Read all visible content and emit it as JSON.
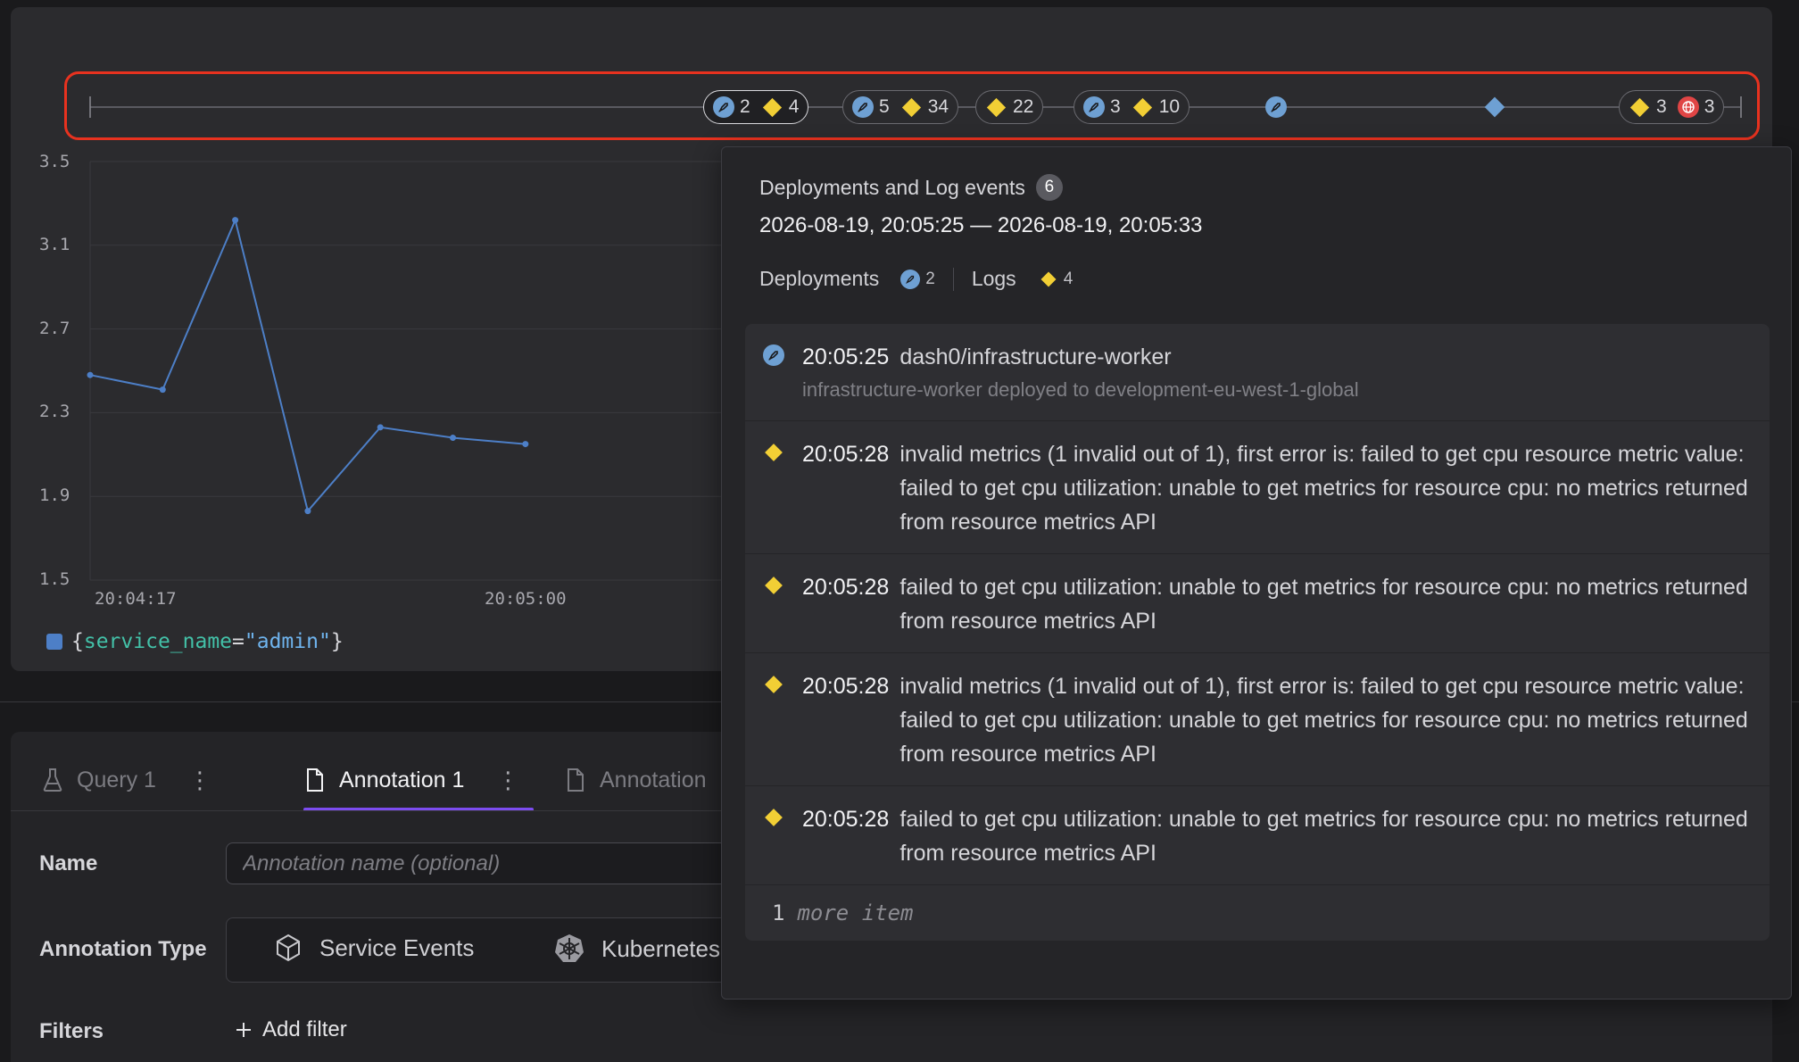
{
  "chart_data": {
    "type": "line",
    "series": [
      {
        "name": "{service_name=\"admin\"}",
        "x": [
          "20:04:17",
          "20:04:25",
          "20:04:33",
          "20:04:41",
          "20:04:49",
          "20:04:57",
          "20:05:05"
        ],
        "values": [
          2.48,
          2.41,
          3.22,
          1.83,
          2.23,
          2.18,
          2.15
        ],
        "color": "#4d7fc7"
      }
    ],
    "yticks": [
      "3.5",
      "3.1",
      "2.7",
      "2.3",
      "1.9",
      "1.5"
    ],
    "ylim": [
      1.5,
      3.5
    ],
    "xticks": [
      "20:04:17",
      "20:05:00"
    ],
    "grid": true,
    "legend_placement": "bottom-left"
  },
  "legend": {
    "open": "{",
    "key": "service_name",
    "eq": "=",
    "value": "\"admin\"",
    "close": "}"
  },
  "timeline": {
    "pills": [
      {
        "deploys": "2",
        "logs": "4",
        "active": true
      },
      {
        "deploys": "5",
        "logs": "34"
      },
      {
        "logs": "22"
      },
      {
        "deploys": "3",
        "logs": "10"
      },
      {
        "logs": "3",
        "errors": "3"
      }
    ],
    "colors": {
      "deploy": "#6ea0d3",
      "log": "#f2cf35",
      "error": "#e04545",
      "highlight_frame": "#e8321f"
    }
  },
  "tooltip": {
    "title": "Deployments and Log events",
    "count": "6",
    "range": "2026-08-19, 20:05:25 — 2026-08-19, 20:05:33",
    "deployments_label": "Deployments",
    "deployments_count": "2",
    "logs_label": "Logs",
    "logs_count": "4",
    "items": [
      {
        "kind": "deploy",
        "time": "20:05:25",
        "message": "dash0/infrastructure-worker",
        "detail": "infrastructure-worker deployed to development-eu-west-1-global"
      },
      {
        "kind": "log",
        "time": "20:05:28",
        "message": "invalid metrics (1 invalid out of 1), first error is: failed to get cpu resource metric value: failed to get cpu utilization: unable to get metrics for resource cpu: no metrics returned from resource metrics API"
      },
      {
        "kind": "log",
        "time": "20:05:28",
        "message": "failed to get cpu utilization: unable to get metrics for resource cpu: no metrics returned from resource metrics API"
      },
      {
        "kind": "log",
        "time": "20:05:28",
        "message": "invalid metrics (1 invalid out of 1), first error is: failed to get cpu resource metric value: failed to get cpu utilization: unable to get metrics for resource cpu: no metrics returned from resource metrics API"
      },
      {
        "kind": "log",
        "time": "20:05:28",
        "message": "failed to get cpu utilization: unable to get metrics for resource cpu: no metrics returned from resource metrics API"
      }
    ],
    "more_count": "1",
    "more_label": "more item"
  },
  "editor": {
    "tabs": [
      "Query 1",
      "Annotation 1",
      "Annotation"
    ],
    "name_label": "Name",
    "name_placeholder": "Annotation name (optional)",
    "type_label": "Annotation Type",
    "type_options": [
      "Service Events",
      "Kubernetes"
    ],
    "filters_label": "Filters",
    "add_filter_label": "Add filter",
    "accent_color": "#7c4cf0"
  }
}
